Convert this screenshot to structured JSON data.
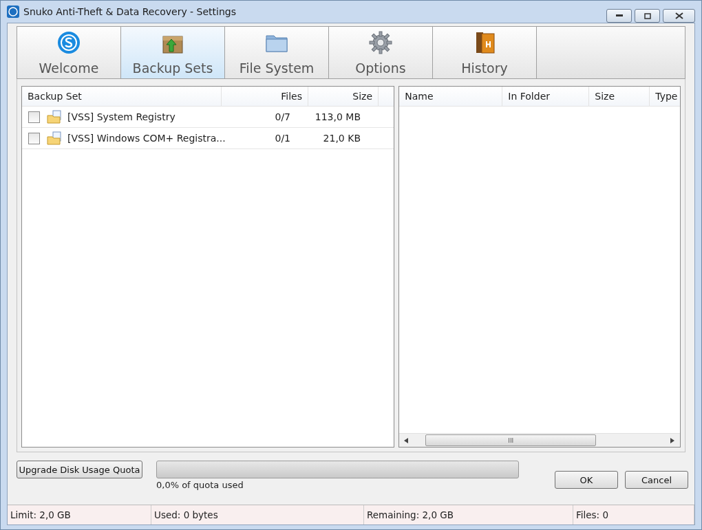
{
  "window": {
    "title": "Snuko Anti-Theft & Data Recovery - Settings"
  },
  "tabs": [
    {
      "label": "Welcome",
      "kind": "logo",
      "selected": false
    },
    {
      "label": "Backup Sets",
      "kind": "box",
      "selected": true
    },
    {
      "label": "File System",
      "kind": "folder",
      "selected": false
    },
    {
      "label": "Options",
      "kind": "gear",
      "selected": false
    },
    {
      "label": "History",
      "kind": "books",
      "selected": false
    }
  ],
  "backup_sets": {
    "columns": [
      "Backup Set",
      "Files",
      "Size"
    ],
    "rows": [
      {
        "name": "[VSS] System Registry",
        "files": "0/7",
        "size": "113,0 MB",
        "checked": false
      },
      {
        "name": "[VSS] Windows COM+ Registra...",
        "files": "0/1",
        "size": "21,0 KB",
        "checked": false
      }
    ]
  },
  "files": {
    "columns": [
      "Name",
      "In Folder",
      "Size",
      "Type"
    ],
    "scroll_grip": "III"
  },
  "quota": {
    "button": "Upgrade Disk Usage Quota",
    "level": 0,
    "caption": "0,0% of quota used"
  },
  "buttons": [
    "OK",
    "Cancel"
  ],
  "status_bar": [
    "Limit: 2,0 GB",
    "Used: 0 bytes",
    "Remaining: 2,0 GB",
    "Files: 0"
  ]
}
